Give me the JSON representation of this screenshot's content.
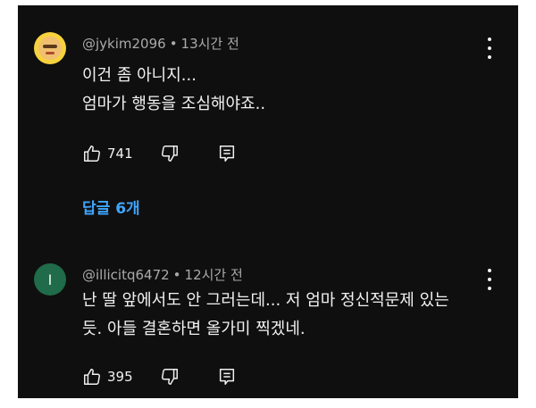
{
  "comments": [
    {
      "author": "@jykim2096",
      "time": "13시간 전",
      "lines": [
        "이건 좀 아니지...",
        "엄마가 행동을 조심해야죠.."
      ],
      "likes": "741"
    },
    {
      "author": "@illicitq6472",
      "avatar_letter": "I",
      "time": "12시간 전",
      "lines": [
        "난 딸 앞에서도 안 그러는데... 저 엄마 정신적문제 있는",
        "듯. 아들 결혼하면 올가미 찍겠네."
      ],
      "likes": "395"
    }
  ],
  "replies_label": "답글 6개",
  "separator": "•",
  "colors": {
    "background": "#0f0f0f",
    "link": "#3ea6ff",
    "text": "#f1f1f1",
    "meta": "#aaaaaa"
  },
  "icons": [
    "thumb-up-icon",
    "thumb-down-icon",
    "reply-icon",
    "more-vert-icon"
  ]
}
